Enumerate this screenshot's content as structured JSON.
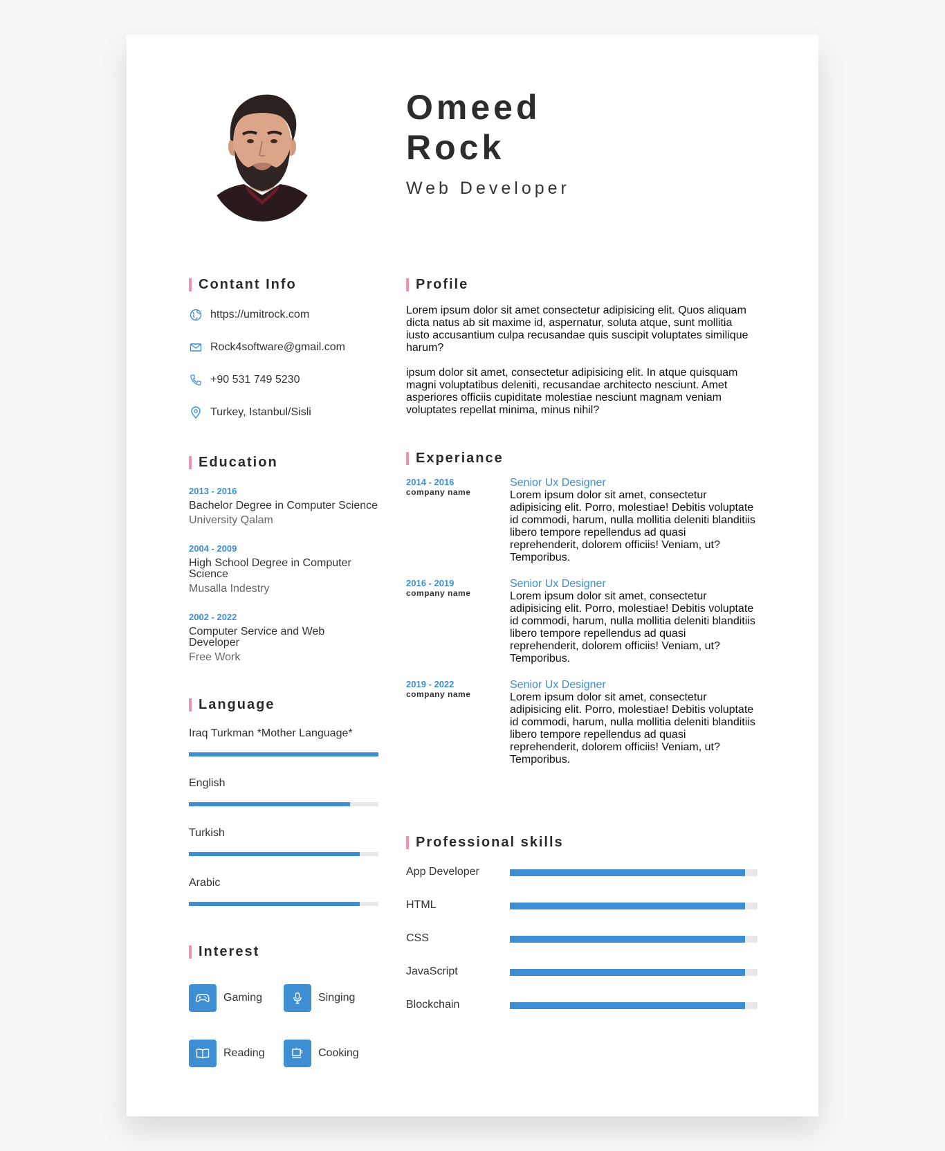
{
  "header": {
    "first_name": "Omeed",
    "last_name": "Rock",
    "role": "Web Developer"
  },
  "contact": {
    "title": "Contant Info",
    "items": [
      {
        "icon": "globe-icon",
        "text": "https://umitrock.com"
      },
      {
        "icon": "mail-icon",
        "text": "Rock4software@gmail.com"
      },
      {
        "icon": "phone-icon",
        "text": "+90 531 749 5230"
      },
      {
        "icon": "location-pin-icon",
        "text": "Turkey, Istanbul/Sisli"
      }
    ]
  },
  "education": {
    "title": "Education",
    "items": [
      {
        "years": "2013 - 2016",
        "degree": "Bachelor Degree in Computer Science",
        "school": "University Qalam"
      },
      {
        "years": "2004 - 2009",
        "degree": "High School Degree in Computer Science",
        "school": "Musalla Indestry"
      },
      {
        "years": "2002 - 2022",
        "degree": "Computer Service and Web Developer",
        "school": "Free Work"
      }
    ]
  },
  "language": {
    "title": "Language",
    "items": [
      {
        "name": "Iraq Turkman *Mother Language*",
        "level": 1.0
      },
      {
        "name": "English",
        "level": 0.85
      },
      {
        "name": "Turkish",
        "level": 0.9
      },
      {
        "name": "Arabic",
        "level": 0.9
      }
    ]
  },
  "interest": {
    "title": "Interest",
    "items": [
      {
        "icon": "gamepad-icon",
        "label": "Gaming"
      },
      {
        "icon": "microphone-icon",
        "label": "Singing"
      },
      {
        "icon": "book-icon",
        "label": "Reading"
      },
      {
        "icon": "coffee-cup-icon",
        "label": "Cooking"
      }
    ]
  },
  "profile": {
    "title": "Profile",
    "paragraphs": [
      "Lorem ipsum dolor sit amet consectetur adipisicing elit. Quos aliquam dicta natus ab sit maxime id, aspernatur, soluta atque, sunt mollitia iusto accusantium culpa recusandae quis suscipit voluptates similique harum?",
      "ipsum dolor sit amet, consectetur adipisicing elit. In atque quisquam magni voluptatibus deleniti, recusandae architecto nesciunt. Amet asperiores officiis cupiditate molestiae nesciunt magnam veniam voluptates repellat minima, minus nihil?"
    ]
  },
  "experience": {
    "title": "Experiance",
    "items": [
      {
        "years": "2014 - 2016",
        "company": "company name",
        "title": "Senior Ux Designer",
        "description": "Lorem ipsum dolor sit amet, consectetur adipisicing elit. Porro, molestiae! Debitis voluptate id commodi, harum, nulla mollitia deleniti blanditiis libero tempore repellendus ad quasi reprehenderit, dolorem officiis! Veniam, ut? Temporibus."
      },
      {
        "years": "2016 - 2019",
        "company": "company name",
        "title": "Senior Ux Designer",
        "description": "Lorem ipsum dolor sit amet, consectetur adipisicing elit. Porro, molestiae! Debitis voluptate id commodi, harum, nulla mollitia deleniti blanditiis libero tempore repellendus ad quasi reprehenderit, dolorem officiis! Veniam, ut? Temporibus."
      },
      {
        "years": "2019 - 2022",
        "company": "company name",
        "title": "Senior Ux Designer",
        "description": "Lorem ipsum dolor sit amet, consectetur adipisicing elit. Porro, molestiae! Debitis voluptate id commodi, harum, nulla mollitia deleniti blanditiis libero tempore repellendus ad quasi reprehenderit, dolorem officiis! Veniam, ut? Temporibus."
      }
    ]
  },
  "skills": {
    "title": "Professional skills",
    "items": [
      {
        "name": "App Developer",
        "level": 0.95
      },
      {
        "name": "HTML",
        "level": 0.95
      },
      {
        "name": "CSS",
        "level": 0.95
      },
      {
        "name": "JavaScript",
        "level": 0.95
      },
      {
        "name": "Blockchain",
        "level": 0.95
      }
    ]
  },
  "colors": {
    "accent": "#3d8ed3",
    "section_marker": "#f48fb1",
    "bar_track": "#e8e8e8"
  }
}
